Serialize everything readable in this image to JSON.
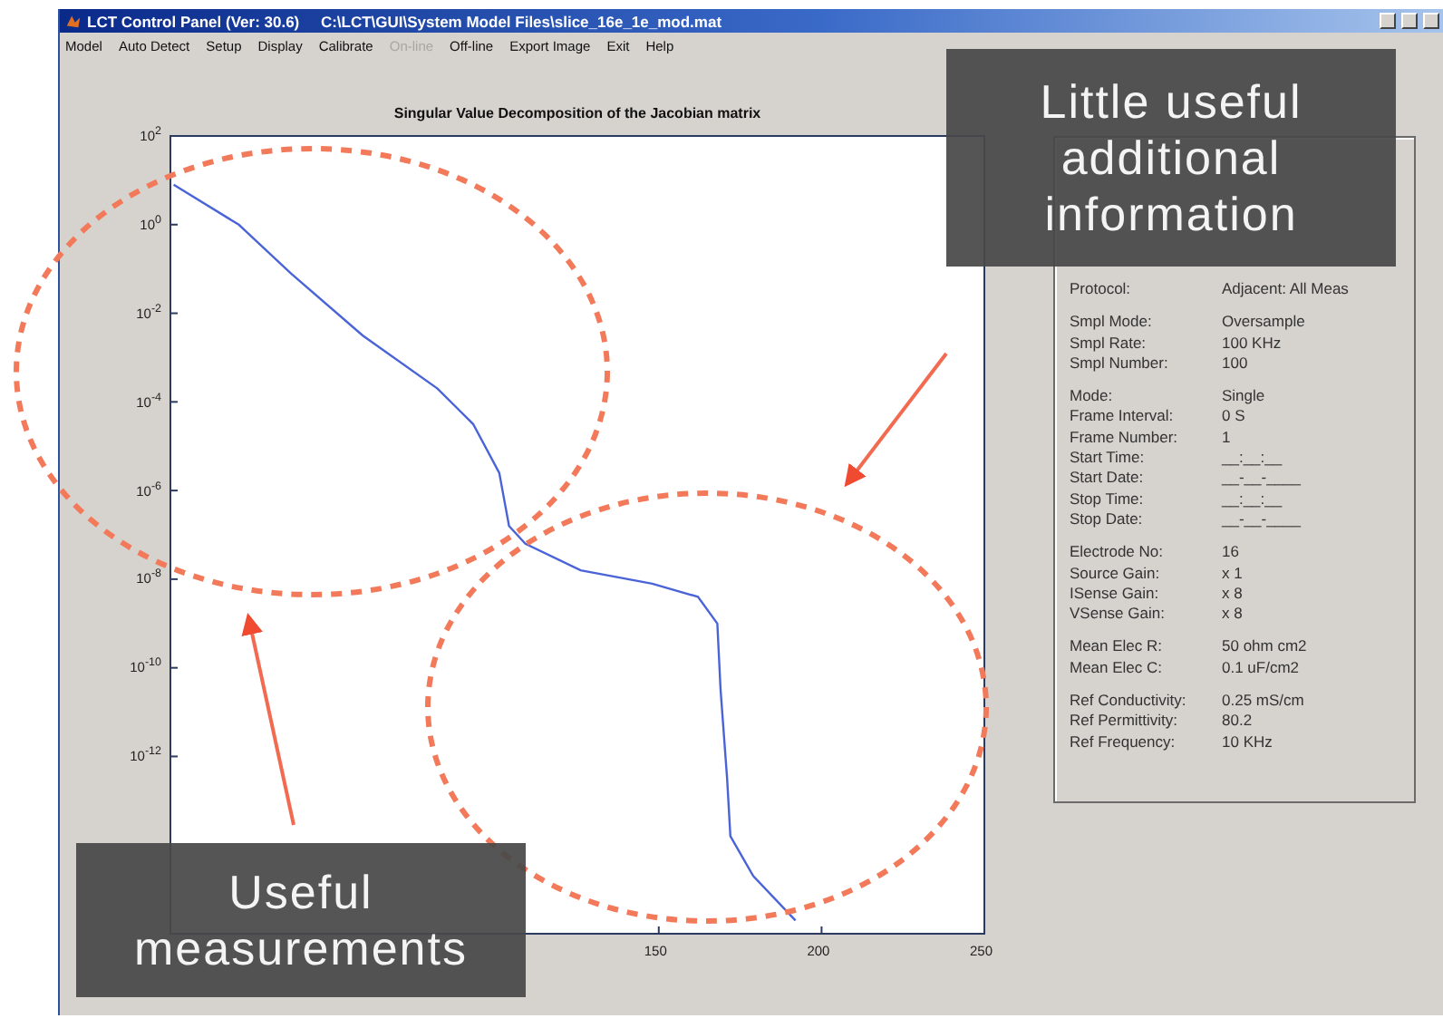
{
  "window": {
    "title": "LCT Control Panel (Ver: 30.6)     C:\\LCT\\GUI\\System Model Files\\slice_16e_1e_mod.mat"
  },
  "menu": [
    {
      "label": "Model",
      "disabled": false
    },
    {
      "label": "Auto Detect",
      "disabled": false
    },
    {
      "label": "Setup",
      "disabled": false
    },
    {
      "label": "Display",
      "disabled": false
    },
    {
      "label": "Calibrate",
      "disabled": false
    },
    {
      "label": "On-line",
      "disabled": true
    },
    {
      "label": "Off-line",
      "disabled": false
    },
    {
      "label": "Export Image",
      "disabled": false
    },
    {
      "label": "Exit",
      "disabled": false
    },
    {
      "label": "Help",
      "disabled": false
    }
  ],
  "plot": {
    "title": "Singular Value Decomposition of the Jacobian matrix",
    "y_tick_labels": [
      "10$^{2}$",
      "10$^{0}$",
      "10$^{-2}$",
      "10$^{-4}$",
      "10$^{-6}$",
      "10$^{-8}$",
      "10$^{-10}$",
      "10$^{-12}$"
    ],
    "x_tick_labels": [
      "150",
      "200",
      "250"
    ]
  },
  "info_panel": {
    "groups": [
      [
        {
          "label": "Protocol:",
          "value": "Adjacent: All Meas"
        }
      ],
      [
        {
          "label": "Smpl Mode:",
          "value": "Oversample"
        },
        {
          "label": "Smpl Rate:",
          "value": "100 KHz"
        },
        {
          "label": "Smpl Number:",
          "value": "100"
        }
      ],
      [
        {
          "label": "Mode:",
          "value": "Single"
        },
        {
          "label": "Frame Interval:",
          "value": "0 S"
        },
        {
          "label": "Frame Number:",
          "value": "1"
        },
        {
          "label": "Start Time:",
          "value": "__:__:__"
        },
        {
          "label": "Start Date:",
          "value": "__-__-____"
        },
        {
          "label": "Stop Time:",
          "value": "__:__:__"
        },
        {
          "label": "Stop Date:",
          "value": "__-__-____"
        }
      ],
      [
        {
          "label": "Electrode No:",
          "value": "16"
        },
        {
          "label": "Source Gain:",
          "value": "x 1"
        },
        {
          "label": "ISense Gain:",
          "value": "x 8"
        },
        {
          "label": "VSense Gain:",
          "value": "x 8"
        }
      ],
      [
        {
          "label": "Mean Elec R:",
          "value": "50 ohm cm2"
        },
        {
          "label": "Mean Elec C:",
          "value": "0.1 uF/cm2"
        }
      ],
      [
        {
          "label": "Ref Conductivity:",
          "value": "0.25 mS/cm"
        },
        {
          "label": "Ref Permittivity:",
          "value": "80.2"
        },
        {
          "label": "Ref Frequency:",
          "value": "10 KHz"
        }
      ]
    ]
  },
  "annotations": [
    {
      "text": "Little useful\nadditional\ninformation"
    },
    {
      "text": "Useful\nmeasurements"
    }
  ]
}
